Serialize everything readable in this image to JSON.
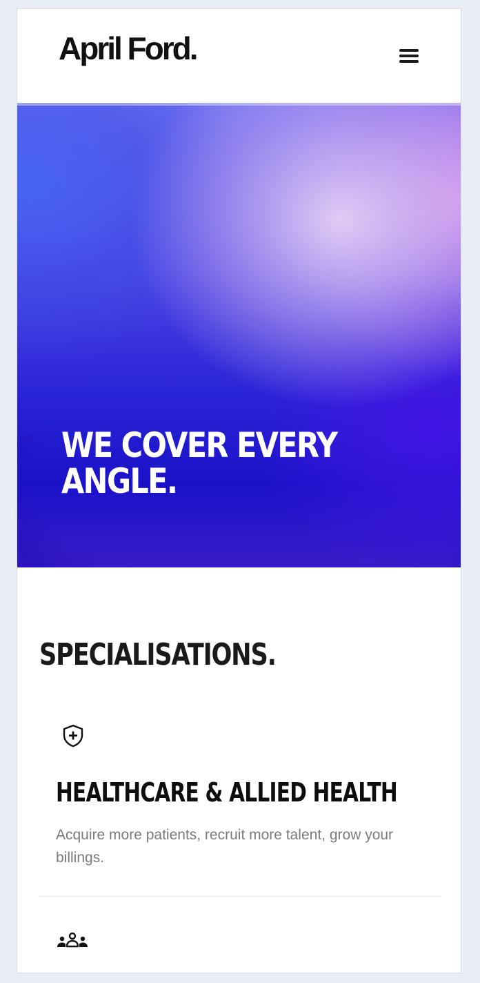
{
  "header": {
    "logo_text": "April Ford.",
    "menu_icon": "hamburger-menu-icon"
  },
  "hero": {
    "title": "WE COVER EVERY ANGLE."
  },
  "specialisations": {
    "title": "SPECIALISATIONS.",
    "items": [
      {
        "icon": "shield-plus-icon",
        "heading": "HEALTHCARE & ALLIED HEALTH",
        "description": "Acquire more patients, recruit more talent, grow your billings."
      },
      {
        "icon": "people-group-icon"
      }
    ]
  },
  "colors": {
    "background": "#e9edf5",
    "text_dark": "#0e0e0e",
    "text_muted": "#7a7a7a",
    "hero_blue": "#2a25d6",
    "hero_pink": "#e0a8f0"
  }
}
